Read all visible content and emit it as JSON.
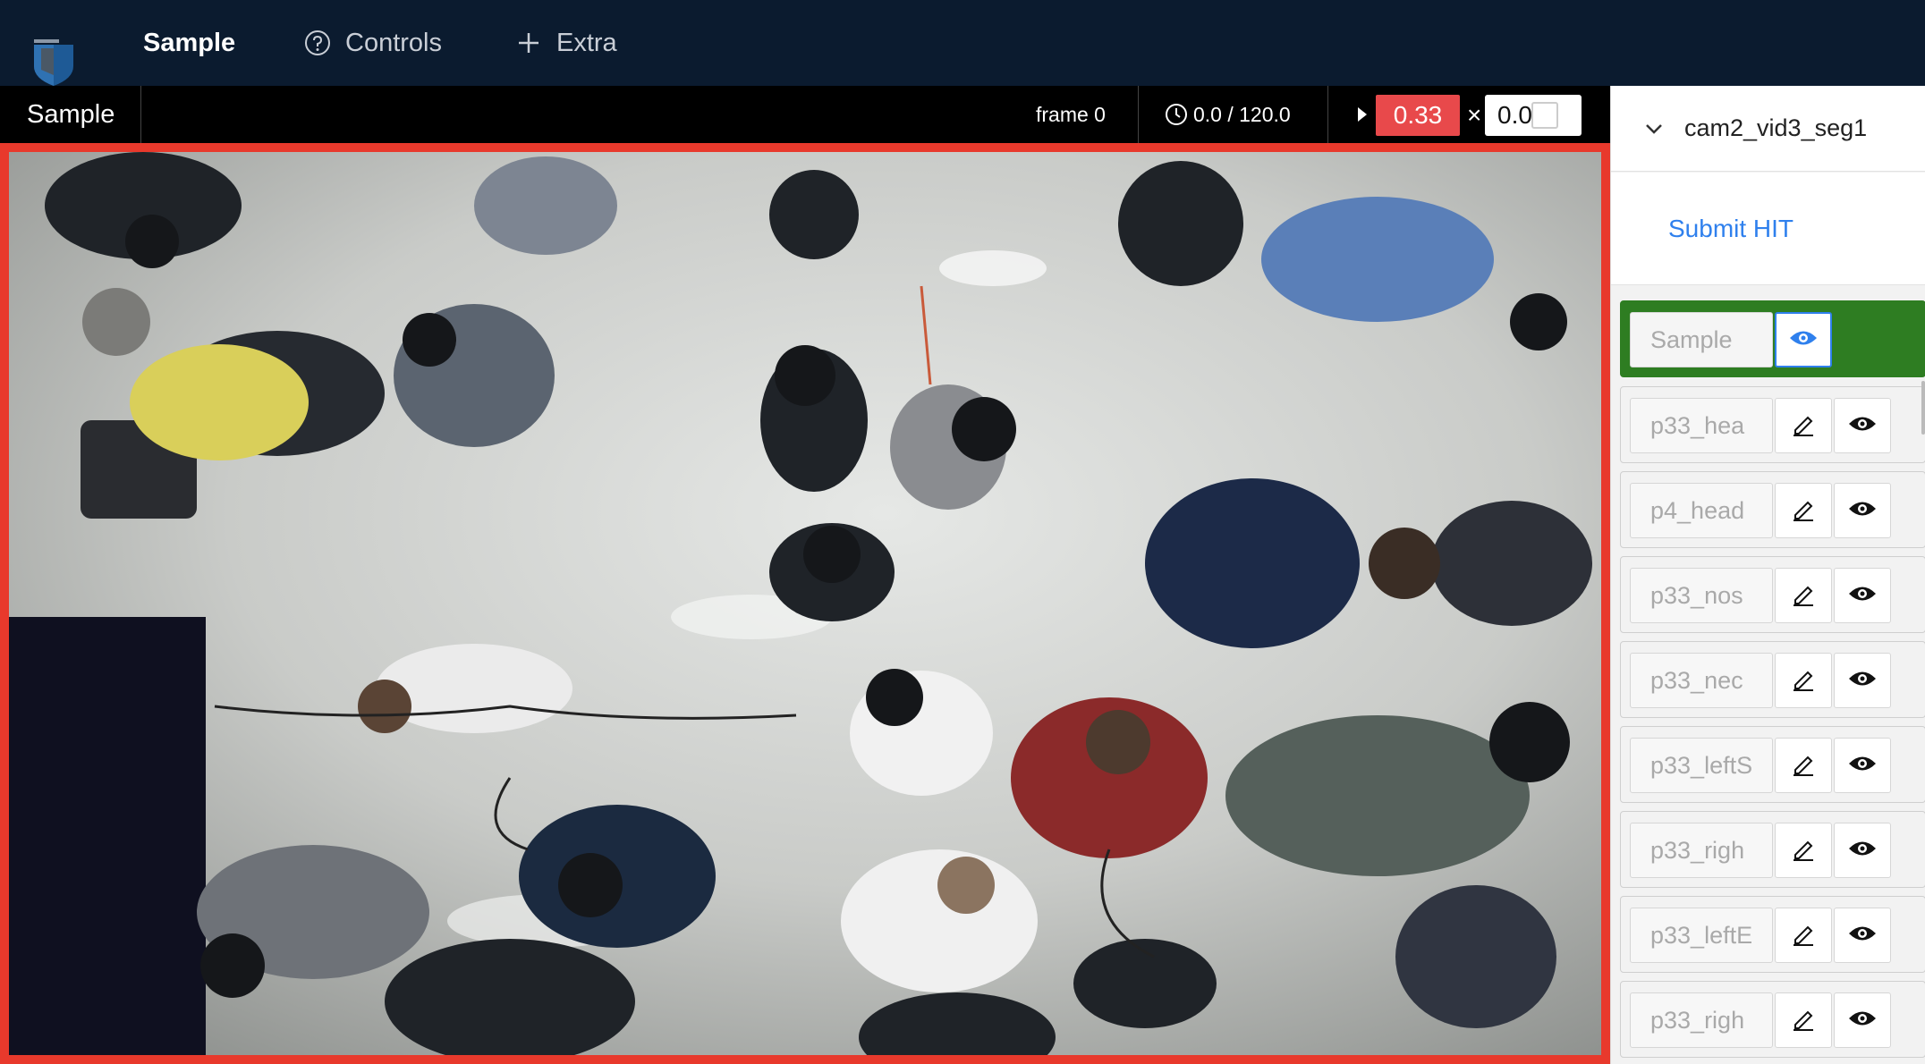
{
  "nav": {
    "items": [
      {
        "label": "Sample",
        "icon": "none",
        "active": true
      },
      {
        "label": "Controls",
        "icon": "question-circle-icon"
      },
      {
        "label": "Extra",
        "icon": "plus-icon"
      }
    ]
  },
  "toolbar": {
    "tab_label": "Sample",
    "frame_label": "frame 0",
    "time_label": "0.0 / 120.0",
    "speed_value": "0.33",
    "times_sign": "×",
    "zoom_value": "0.0"
  },
  "panel": {
    "video_name": "cam2_vid3_seg1",
    "submit_label": "Submit HIT",
    "layers": [
      {
        "name": "Sample",
        "selected": true
      },
      {
        "name": "p33_hea"
      },
      {
        "name": "p4_head"
      },
      {
        "name": "p33_nos"
      },
      {
        "name": "p33_nec"
      },
      {
        "name": "p33_leftS"
      },
      {
        "name": "p33_righ"
      },
      {
        "name": "p33_leftE"
      },
      {
        "name": "p33_righ"
      }
    ]
  },
  "colors": {
    "nav_bg": "#0b1b2f",
    "frame_border": "#e8392c",
    "speed_badge": "#e8494b",
    "selected_row": "#2e7d22",
    "link": "#2f80ed"
  }
}
